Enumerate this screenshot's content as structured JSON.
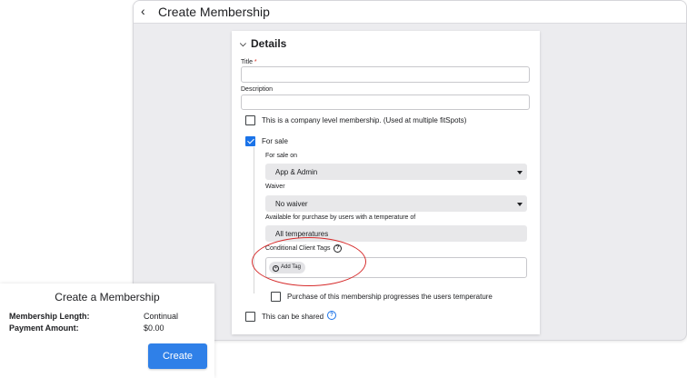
{
  "window": {
    "title": "Create Membership"
  },
  "form": {
    "section_title": "Details",
    "title_label": "Title",
    "title_required_mark": "*",
    "title_value": "",
    "description_label": "Description",
    "description_value": "",
    "company_level": {
      "label": "This is a company level membership. (Used at multiple fitSpots)",
      "checked": false
    },
    "for_sale": {
      "label": "For sale",
      "checked": true
    },
    "for_sale_on": {
      "label": "For sale on",
      "value": "App & Admin"
    },
    "waiver": {
      "label": "Waiver",
      "value": "No waiver"
    },
    "temperature": {
      "label": "Available for purchase by users with a temperature of",
      "value": "All temperatures"
    },
    "tags": {
      "label": "Conditional Client Tags",
      "add_label": "Add Tag"
    },
    "progress_temp": {
      "label": "Purchase of this membership progresses the users temperature",
      "checked": false
    },
    "shared": {
      "label": "This can be shared",
      "checked": false
    }
  },
  "popup": {
    "title": "Create a Membership",
    "rows": [
      {
        "label": "Membership Length:",
        "value": "Continual"
      },
      {
        "label": "Payment Amount:",
        "value": "$0.00"
      }
    ],
    "create_label": "Create"
  },
  "colors": {
    "accent": "#1a73e8",
    "create_button": "#2f80e8",
    "highlight": "#d62b2b"
  },
  "icons": {
    "back": "chevron-left-icon",
    "collapse": "chevron-down-icon",
    "help": "question-circle-icon",
    "add": "plus-circle-icon"
  }
}
